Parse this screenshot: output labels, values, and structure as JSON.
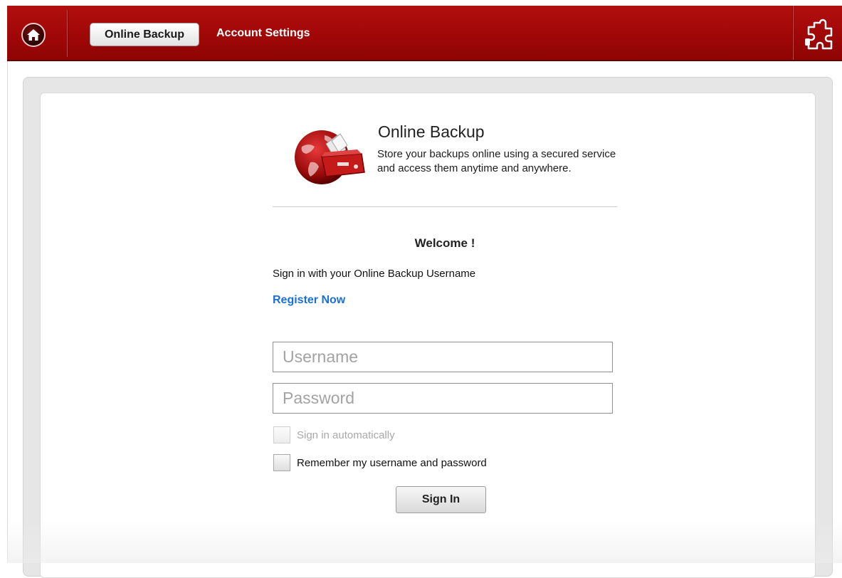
{
  "header": {
    "home_icon": "home-icon",
    "tabs": [
      {
        "label": "Online Backup",
        "active": true
      },
      {
        "label": "Account Settings",
        "active": false
      }
    ],
    "plugin_icon": "puzzle-piece-icon",
    "colors": {
      "bar": "#a40808",
      "active_tab_bg": "#ffffff"
    }
  },
  "hero": {
    "logo": "online-backup-globe-box-icon",
    "title": "Online Backup",
    "description": "Store your backups online using a secured service and access them anytime and anywhere."
  },
  "login": {
    "welcome": "Welcome !",
    "instruction": "Sign in with your Online Backup Username",
    "register_link": "Register Now",
    "username_placeholder": "Username",
    "password_placeholder": "Password",
    "auto_signin_label": "Sign in automatically",
    "auto_signin_checked": false,
    "auto_signin_enabled": false,
    "remember_label": "Remember my username and password",
    "remember_checked": false,
    "submit_label": "Sign In",
    "link_color": "#1b6fd8"
  }
}
